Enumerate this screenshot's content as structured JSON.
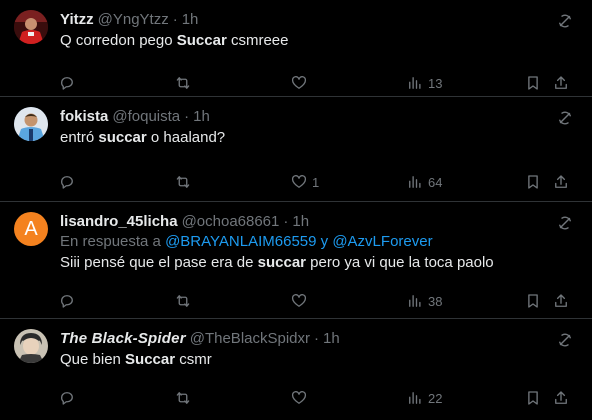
{
  "tweets": [
    {
      "name": "Yitzz",
      "handle": "@YngYtzz",
      "time": "1h",
      "reply_to_prefix": "",
      "text_before": "Q corredon pego ",
      "text_bold": "Succar",
      "text_after": " csmreee",
      "replies": "",
      "retweets": "",
      "likes": "",
      "views": "13",
      "avatar_icon": "red-jersey-player-avatar"
    },
    {
      "name": "fokista",
      "handle": "@foquista",
      "time": "1h",
      "reply_to_prefix": "",
      "text_before": "entró ",
      "text_bold": "succar",
      "text_after": " o haaland?",
      "replies": "",
      "retweets": "",
      "likes": "1",
      "views": "64",
      "avatar_icon": "blue-jersey-player-avatar"
    },
    {
      "name": "lisandro_45licha",
      "handle": "@ochoa68661",
      "time": "1h",
      "reply_to_prefix": "En respuesta a ",
      "reply_to_a": "@BRAYANLAIM66559",
      "reply_to_join": " y ",
      "reply_to_b": "@AzvLForever",
      "text_before": "Siii pensé que el pase era de ",
      "text_bold": "succar",
      "text_after": " pero ya vi  que la toca paolo",
      "replies": "",
      "retweets": "",
      "likes": "",
      "views": "38",
      "avatar_letter": "A",
      "avatar_color": "#f4821f"
    },
    {
      "name": "The Black-Spider",
      "handle": "@TheBlackSpidxr",
      "time": "1h",
      "reply_to_prefix": "",
      "text_before": "Que bien ",
      "text_bold": "Succar",
      "text_after": " csmr",
      "replies": "",
      "retweets": "",
      "likes": "",
      "views": "22",
      "avatar_icon": "anime-character-avatar"
    }
  ],
  "colors": {
    "background": "#000000",
    "text": "#e7e9ea",
    "muted": "#71767b",
    "link": "#1d9bf0",
    "divider": "#2f3336"
  },
  "icons": [
    "reply-icon",
    "retweet-icon",
    "like-icon",
    "views-icon",
    "bookmark-icon",
    "share-icon",
    "grok-icon"
  ]
}
